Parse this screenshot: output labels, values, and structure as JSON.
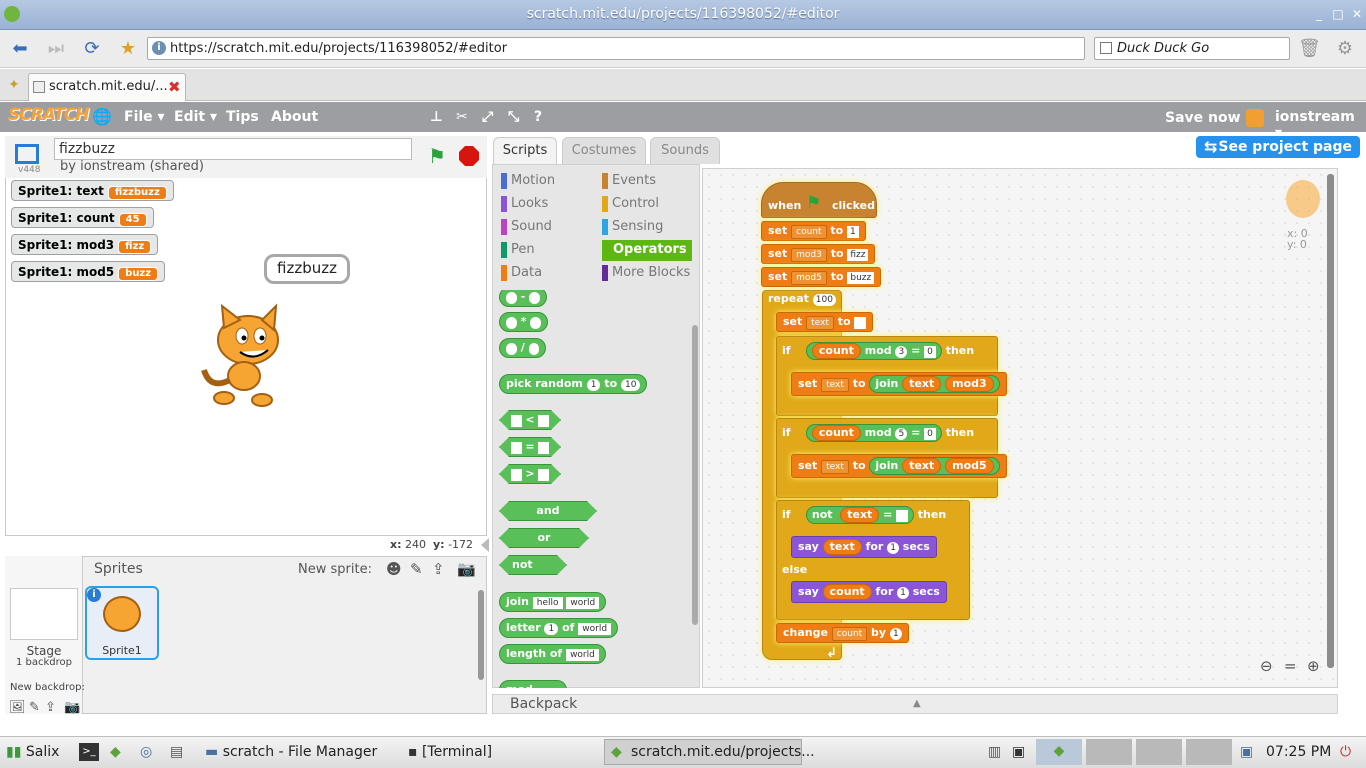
{
  "window": {
    "title": "scratch.mit.edu/projects/116398052/#editor"
  },
  "browser": {
    "url": "https://scratch.mit.edu/projects/116398052/#editor",
    "search_placeholder": "Duck Duck Go",
    "tab_title": "scratch.mit.edu/..."
  },
  "scratch_menu": {
    "logo": "SCRATCH",
    "items": [
      "File ▾",
      "Edit ▾",
      "Tips",
      "About"
    ],
    "save": "Save now",
    "user": "ionstream ▾"
  },
  "stage": {
    "project_name": "fizzbuzz",
    "byline": "by ionstream (shared)",
    "version": "v448",
    "monitors": [
      {
        "label": "Sprite1: text",
        "value": "fizzbuzz"
      },
      {
        "label": "Sprite1: count",
        "value": "45"
      },
      {
        "label": "Sprite1: mod3",
        "value": "fizz"
      },
      {
        "label": "Sprite1: mod5",
        "value": "buzz"
      }
    ],
    "speech": "fizzbuzz",
    "x_label": "x:",
    "x_val": "240",
    "y_label": "y:",
    "y_val": "-172"
  },
  "sprites": {
    "header": "Sprites",
    "new_sprite": "New sprite:",
    "stage_label": "Stage",
    "stage_backdrops": "1 backdrop",
    "new_backdrop": "New backdrop:",
    "sprite1": "Sprite1"
  },
  "editor_tabs": [
    "Scripts",
    "Costumes",
    "Sounds"
  ],
  "see_project": "See project page",
  "categories": {
    "left": [
      "Motion",
      "Looks",
      "Sound",
      "Pen",
      "Data"
    ],
    "right": [
      "Events",
      "Control",
      "Sensing",
      "Operators",
      "More Blocks"
    ],
    "colors_left": [
      "#4a6cd4",
      "#8a55d7",
      "#bb42c3",
      "#0e9a6c",
      "#ee7d16"
    ],
    "colors_right": [
      "#c88330",
      "#e1a91a",
      "#2ca5e2",
      "#5cb712",
      "#632d99"
    ]
  },
  "palette": {
    "minus": "-",
    "times": "*",
    "divide": "/",
    "pick_random": "pick random",
    "pr_from": "1",
    "pr_to_word": "to",
    "pr_to": "10",
    "lt": "<",
    "eq": "=",
    "gt": ">",
    "and": "and",
    "or": "or",
    "not": "not",
    "join": "join",
    "join_a": "hello",
    "join_b": "world",
    "letter": "letter",
    "letter_n": "1",
    "letter_of": "of",
    "letter_s": "world",
    "length": "length",
    "length_of": "of",
    "length_s": "world",
    "mod": "mod"
  },
  "script": {
    "when": "when",
    "clicked": "clicked",
    "set": "set",
    "to": "to",
    "var_count": "count",
    "var_mod3": "mod3",
    "var_mod5": "mod5",
    "var_text": "text",
    "one": "1",
    "fizz": "fizz",
    "buzz": "buzz",
    "repeat": "repeat",
    "hundred": "100",
    "if": "if",
    "then": "then",
    "mod": "mod",
    "three": "3",
    "five": "5",
    "zero": "0",
    "eq": "=",
    "join": "join",
    "not": "not",
    "say": "say",
    "for": "for",
    "secs": "secs",
    "else": "else",
    "change": "change",
    "by": "by"
  },
  "sprite_info": {
    "x": "x: 0",
    "y": "y: 0"
  },
  "backpack": "Backpack",
  "taskbar": {
    "start": "Salix",
    "items": [
      "scratch - File Manager",
      "[Terminal]",
      "scratch.mit.edu/projects..."
    ],
    "clock": "07:25 PM"
  }
}
